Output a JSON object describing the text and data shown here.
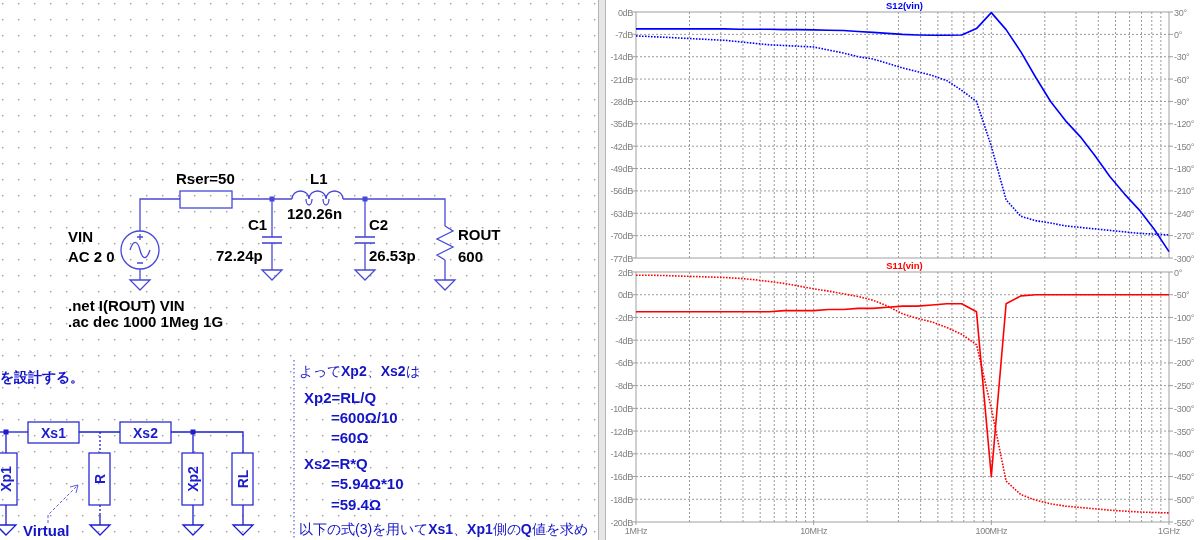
{
  "schematic": {
    "components": [
      {
        "kind": "voltage_source",
        "labels": [
          "VIN",
          "AC 2 0"
        ]
      },
      {
        "kind": "resistor",
        "labels": [
          "Rser=50"
        ]
      },
      {
        "kind": "capacitor",
        "labels": [
          "C1",
          "72.24p"
        ]
      },
      {
        "kind": "inductor",
        "labels": [
          "L1",
          "120.26n"
        ]
      },
      {
        "kind": "capacitor",
        "labels": [
          "C2",
          "26.53p"
        ]
      },
      {
        "kind": "load_resistor",
        "labels": [
          "ROUT",
          "600"
        ]
      }
    ],
    "directives": [
      ".net I(ROUT) VIN",
      ".ac dec 1000 1Meg 1G"
    ],
    "model_blocks": [
      {
        "kind": "series",
        "label": "Xs1"
      },
      {
        "kind": "series",
        "label": "Xs2"
      },
      {
        "kind": "shunt",
        "label": "Xp1"
      },
      {
        "kind": "virtual",
        "label": "R"
      },
      {
        "kind": "shunt",
        "label": "Xp2"
      },
      {
        "kind": "shunt",
        "label": "RL"
      }
    ],
    "notes": [
      "を設計する。",
      "よって**Xp2**、**Xs2**は",
      "Xp2=RL/Q",
      "=600Ω/10",
      "=60Ω",
      "Xs2=R*Q",
      "=5.94Ω*10",
      "=59.4Ω",
      "Virtual",
      "以下の式(3)を用いて**Xs1**、**Xp1**側の**Q**値を求め"
    ]
  },
  "waveform_viewer": {
    "charts": [
      {
        "chart_data": {
          "type": "line",
          "title": "S12(vin)",
          "grid": true,
          "categories": [
            null,
            null,
            null,
            null,
            null,
            null,
            null,
            null,
            null,
            null,
            null,
            null,
            null,
            null,
            null,
            null,
            null,
            null,
            null,
            null,
            null,
            null,
            null,
            null,
            null,
            null,
            null,
            null,
            null,
            null,
            null,
            null,
            null,
            null,
            null,
            null,
            null
          ],
          "ylim": [
            -77,
            0
          ],
          "yticks": [
            {
              "value": 0,
              "label": "0dB"
            },
            {
              "value": -7,
              "label": "-7dB"
            },
            {
              "value": -14,
              "label": "-14dB"
            },
            {
              "value": -21,
              "label": "-21dB"
            },
            {
              "value": -28,
              "label": "-28dB"
            },
            {
              "value": -35,
              "label": "-35dB"
            },
            {
              "value": -42,
              "label": "-42dB"
            },
            {
              "value": -49,
              "label": "-49dB"
            },
            {
              "value": -56,
              "label": "-56dB"
            },
            {
              "value": -63,
              "label": "-63dB"
            },
            {
              "value": -70,
              "label": "-70dB"
            },
            {
              "value": -77,
              "label": "-77dB"
            }
          ],
          "y2lim": [
            -300,
            30
          ],
          "y2ticks": [
            {
              "value": 30,
              "label": "30°"
            },
            {
              "value": 0,
              "label": "0°"
            },
            {
              "value": -30,
              "label": "-30°"
            },
            {
              "value": -60,
              "label": "-60°"
            },
            {
              "value": -90,
              "label": "-90°"
            },
            {
              "value": -120,
              "label": "-120°"
            },
            {
              "value": -150,
              "label": "-150°"
            },
            {
              "value": -180,
              "label": "-180°"
            },
            {
              "value": -210,
              "label": "-210°"
            },
            {
              "value": -240,
              "label": "-240°"
            },
            {
              "value": -270,
              "label": "-270°"
            },
            {
              "value": -300,
              "label": "-300°"
            }
          ],
          "series": [
            {
              "color": "#0000ff",
              "values": [
                -5.3,
                -5.3,
                -5.3,
                -5.3,
                -5.3,
                -5.3,
                -5.3,
                -5.4,
                -5.4,
                -5.4,
                -5.5,
                -5.5,
                -5.6,
                -5.7,
                -5.8,
                -6.1,
                -6.4,
                -6.7,
                -7.0,
                -7.2,
                -7.3,
                -7.3,
                -7.2,
                -5.2,
                -0.2,
                -5.5,
                -12.5,
                -20.5,
                -28,
                -34,
                -39,
                -45,
                -51.5,
                -57,
                -62,
                -68,
                -75
              ]
            },
            {
              "axis": "y2",
              "line_style": "dotted",
              "color": "#0000ff",
              "values": [
                -2,
                -3,
                -4,
                -5,
                -6,
                -7,
                -8,
                -10,
                -12,
                -14,
                -15,
                -16,
                -17,
                -21,
                -25,
                -30,
                -33,
                -39,
                -45,
                -50,
                -55,
                -62,
                -75,
                -90,
                -150,
                -222,
                -244,
                -250,
                -253,
                -257,
                -259,
                -261,
                -263,
                -265,
                -267,
                -268,
                -269
              ]
            }
          ]
        }
      },
      {
        "chart_data": {
          "type": "line",
          "title": "S11(vin)",
          "grid": true,
          "categories": [
            "1MHz",
            null,
            null,
            null,
            null,
            null,
            null,
            null,
            null,
            null,
            null,
            null,
            "10MHz",
            null,
            null,
            null,
            null,
            null,
            null,
            null,
            null,
            null,
            null,
            null,
            "100MHz",
            null,
            null,
            null,
            null,
            null,
            null,
            null,
            null,
            null,
            null,
            null,
            "1GHz"
          ],
          "ylim": [
            -20,
            2
          ],
          "yticks": [
            {
              "value": 2,
              "label": "2dB"
            },
            {
              "value": 0,
              "label": "0dB"
            },
            {
              "value": -2,
              "label": "-2dB"
            },
            {
              "value": -4,
              "label": "-4dB"
            },
            {
              "value": -6,
              "label": "-6dB"
            },
            {
              "value": -8,
              "label": "-8dB"
            },
            {
              "value": -10,
              "label": "-10dB"
            },
            {
              "value": -12,
              "label": "-12dB"
            },
            {
              "value": -14,
              "label": "-14dB"
            },
            {
              "value": -16,
              "label": "-16dB"
            },
            {
              "value": -18,
              "label": "-18dB"
            },
            {
              "value": -20,
              "label": "-20dB"
            }
          ],
          "y2lim": [
            -550,
            0
          ],
          "y2ticks": [
            {
              "value": 0,
              "label": "0°"
            },
            {
              "value": -50,
              "label": "-50°"
            },
            {
              "value": -100,
              "label": "-100°"
            },
            {
              "value": -150,
              "label": "-150°"
            },
            {
              "value": -200,
              "label": "-200°"
            },
            {
              "value": -250,
              "label": "-250°"
            },
            {
              "value": -300,
              "label": "-300°"
            },
            {
              "value": -350,
              "label": "-350°"
            },
            {
              "value": -400,
              "label": "-400°"
            },
            {
              "value": -450,
              "label": "-450°"
            },
            {
              "value": -500,
              "label": "-500°"
            },
            {
              "value": -550,
              "label": "-550°"
            }
          ],
          "series": [
            {
              "color": "#ff0000",
              "values": [
                -1.5,
                -1.5,
                -1.5,
                -1.5,
                -1.5,
                -1.5,
                -1.5,
                -1.5,
                -1.5,
                -1.5,
                -1.4,
                -1.4,
                -1.4,
                -1.3,
                -1.3,
                -1.2,
                -1.2,
                -1.1,
                -1.0,
                -1.0,
                -0.9,
                -0.8,
                -0.8,
                -1.5,
                -16,
                -0.8,
                -0.1,
                0,
                0,
                0,
                0,
                0,
                0,
                0,
                0,
                0,
                0
              ]
            },
            {
              "axis": "y2",
              "line_style": "dotted",
              "color": "#ff0000",
              "values": [
                -7,
                -7,
                -8,
                -9,
                -10,
                -11,
                -12,
                -14,
                -17,
                -21,
                -25,
                -31,
                -37,
                -42,
                -48,
                -54,
                -62,
                -75,
                -92,
                -102,
                -110,
                -122,
                -137,
                -160,
                -300,
                -460,
                -490,
                -502,
                -510,
                -515,
                -518,
                -521,
                -524,
                -526,
                -528,
                -529,
                -530
              ]
            }
          ]
        }
      }
    ]
  }
}
